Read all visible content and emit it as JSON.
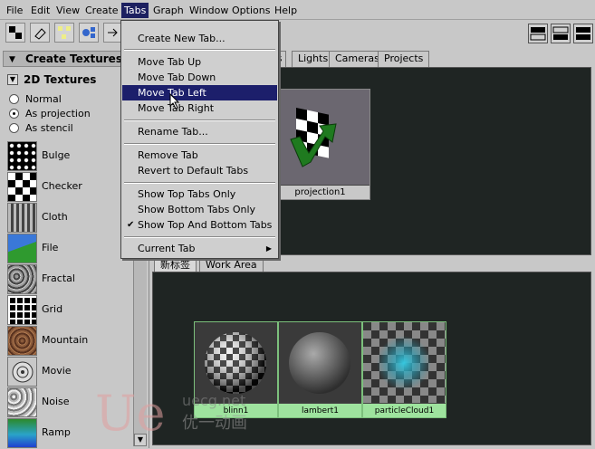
{
  "menubar": {
    "items": [
      "File",
      "Edit",
      "View",
      "Create",
      "Tabs",
      "Graph",
      "Window",
      "Options",
      "Help"
    ],
    "active_index": 4
  },
  "left_panel": {
    "header": "Create Textures",
    "subheader": "2D Textures",
    "radios": [
      {
        "label": "Normal",
        "checked": false
      },
      {
        "label": "As projection",
        "checked": true
      },
      {
        "label": "As stencil",
        "checked": false
      }
    ],
    "textures": [
      "Bulge",
      "Checker",
      "Cloth",
      "File",
      "Fractal",
      "Grid",
      "Mountain",
      "Movie",
      "Noise",
      "Ramp"
    ]
  },
  "top_tabs": [
    "es",
    "Lights",
    "Cameras",
    "Projects"
  ],
  "top_node": {
    "label": "projection1"
  },
  "bottom_tabs": [
    "新标签",
    "Work Area"
  ],
  "materials": [
    {
      "label": "blinn1"
    },
    {
      "label": "lambert1"
    },
    {
      "label": "particleCloud1"
    }
  ],
  "tabs_menu": {
    "items": [
      {
        "label": "Create New Tab..."
      },
      {
        "label": "Move Tab Up"
      },
      {
        "label": "Move Tab Down"
      },
      {
        "label": "Move Tab Left",
        "highlighted": true
      },
      {
        "label": "Move Tab Right"
      },
      {
        "label": "Rename Tab..."
      },
      {
        "label": "Remove Tab"
      },
      {
        "label": "Revert to Default Tabs"
      },
      {
        "label": "Show Top Tabs Only"
      },
      {
        "label": "Show Bottom Tabs Only"
      },
      {
        "label": "Show Top And Bottom Tabs",
        "checked": true
      },
      {
        "label": "Current Tab",
        "submenu": true
      }
    ]
  },
  "watermark": {
    "line1": "uecg.net",
    "line2": "优一动画"
  },
  "colors": {
    "menu_highlight": "#1c1f6b",
    "view_background": "#1f2523",
    "material_label": "#9ee39e"
  }
}
